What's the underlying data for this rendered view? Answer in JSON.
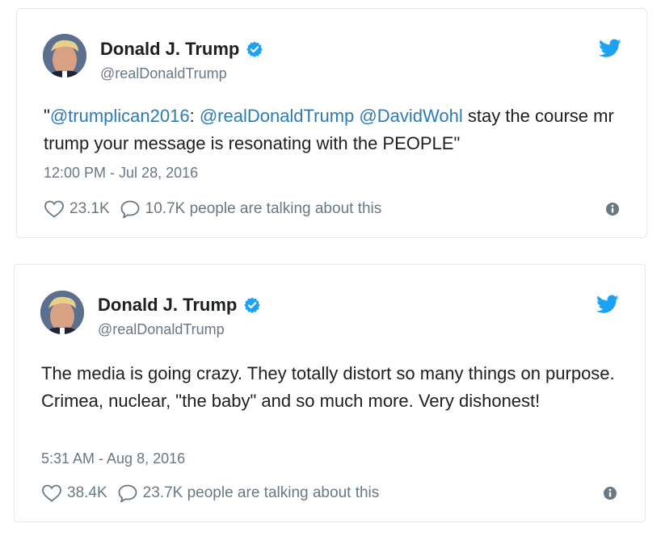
{
  "tweets": [
    {
      "author_name": "Donald J. Trump",
      "handle": "@realDonaldTrump",
      "text_parts": [
        {
          "text": "\"",
          "mention": false
        },
        {
          "text": "@trumplican2016",
          "mention": true
        },
        {
          "text": ": ",
          "mention": false
        },
        {
          "text": "@realDonaldTrump",
          "mention": true
        },
        {
          "text": " ",
          "mention": false
        },
        {
          "text": "@DavidWohl",
          "mention": true
        },
        {
          "text": " stay the course mr trump your message is resonating with the PEOPLE\"",
          "mention": false
        }
      ],
      "timestamp": "12:00 PM - Jul 28, 2016",
      "likes": "23.1K",
      "talking": "10.7K people are talking about this"
    },
    {
      "author_name": "Donald J. Trump",
      "handle": "@realDonaldTrump",
      "text_parts": [
        {
          "text": "The media is going crazy. They totally distort so many things on purpose. Crimea, nuclear, \"the baby\" and so much more. Very dishonest!",
          "mention": false
        }
      ],
      "timestamp": "5:31 AM - Aug 8, 2016",
      "likes": "38.4K",
      "talking": "23.7K people are talking about this"
    }
  ],
  "icons": {
    "verified": "verified-badge-icon",
    "bird": "twitter-bird-icon",
    "heart": "heart-icon",
    "comment": "speech-bubble-icon",
    "info": "info-icon"
  },
  "colors": {
    "brand_blue": "#1da1f2",
    "mention": "#2b7bb9",
    "secondary_text": "#697882",
    "border": "#e1e8ed"
  }
}
